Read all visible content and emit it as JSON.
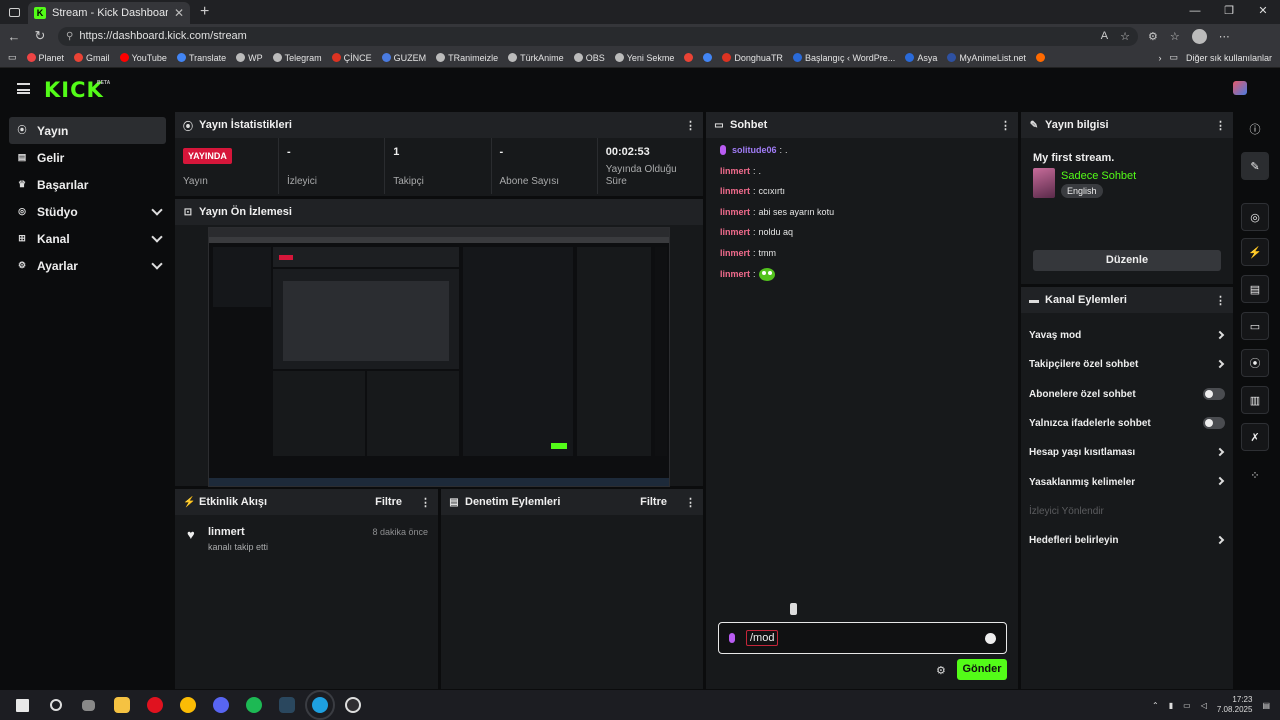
{
  "browser": {
    "tab_title": "Stream - Kick Dashboard",
    "tab_favicon": "K",
    "url": "https://dashboard.kick.com/stream",
    "bookmarks": [
      {
        "label": "Planet",
        "color": "#e44"
      },
      {
        "label": "Gmail",
        "color": "#ea4335"
      },
      {
        "label": "YouTube",
        "color": "#ff0000"
      },
      {
        "label": "Translate",
        "color": "#4285f4"
      },
      {
        "label": "WP",
        "color": "#bbb"
      },
      {
        "label": "Telegram",
        "color": "#bbb"
      },
      {
        "label": "ÇİNCE",
        "color": "#d32"
      },
      {
        "label": "GUZEM",
        "color": "#4a7be0"
      },
      {
        "label": "TRanimeizle",
        "color": "#bbb"
      },
      {
        "label": "TürkAnime",
        "color": "#bbb"
      },
      {
        "label": "OBS",
        "color": "#bbb"
      },
      {
        "label": "Yeni Sekme",
        "color": "#bbb"
      },
      {
        "label": "",
        "color": "#ea4335"
      },
      {
        "label": "",
        "color": "#4285f4"
      },
      {
        "label": "DonghuaTR",
        "color": "#d32"
      },
      {
        "label": "Başlangıç ‹ WordPre...",
        "color": "#2a6ad8"
      },
      {
        "label": "Asya",
        "color": "#2a6ad8"
      },
      {
        "label": "MyAnimeList.net",
        "color": "#2e51a2"
      },
      {
        "label": "",
        "color": "#ff6a00"
      }
    ],
    "other_bookmarks": "Diğer sık kullanılanlar"
  },
  "sidebar": {
    "items": [
      {
        "label": "Yayın",
        "icon": "broadcast-icon",
        "glyph": "((·))"
      },
      {
        "label": "Gelir",
        "icon": "revenue-icon",
        "glyph": "▤"
      },
      {
        "label": "Başarılar",
        "icon": "trophy-icon",
        "glyph": "♛"
      },
      {
        "label": "Stüdyo",
        "icon": "studio-icon",
        "glyph": "◎"
      },
      {
        "label": "Kanal",
        "icon": "channel-icon",
        "glyph": "⊞"
      },
      {
        "label": "Ayarlar",
        "icon": "settings-icon",
        "glyph": "⚙"
      }
    ]
  },
  "stats_panel": {
    "title": "Yayın İstatistikleri",
    "live_badge": "YAYINDA",
    "cells": [
      {
        "value": "",
        "label": "Yayın"
      },
      {
        "value": "-",
        "label": "İzleyici"
      },
      {
        "value": "1",
        "label": "Takipçi"
      },
      {
        "value": "-",
        "label": "Abone Sayısı"
      },
      {
        "value": "00:02:53",
        "label": "Yayında Olduğu Süre"
      }
    ]
  },
  "preview_panel": {
    "title": "Yayın Ön İzlemesi"
  },
  "events_panel": {
    "title": "Etkinlik Akışı",
    "filter": "Filtre",
    "events": [
      {
        "user": "linmert",
        "text": "kanalı takip etti",
        "time": "8 dakika önce"
      }
    ]
  },
  "mod_panel": {
    "title": "Denetim Eylemleri",
    "filter": "Filtre"
  },
  "chat_panel": {
    "title": "Sohbet",
    "messages": [
      {
        "user": "solitude06",
        "text": ".",
        "style": "purple"
      },
      {
        "user": "linmert",
        "text": ".",
        "style": "pink"
      },
      {
        "user": "linmert",
        "text": "ccıxırtı",
        "style": "pink"
      },
      {
        "user": "linmert",
        "text": "abi ses ayarın kotu",
        "style": "pink"
      },
      {
        "user": "linmert",
        "text": "noldu aq",
        "style": "pink"
      },
      {
        "user": "linmert",
        "text": "tmm",
        "style": "pink"
      },
      {
        "user": "linmert",
        "text": "",
        "style": "pink",
        "emote": true
      }
    ],
    "input_value": "/mod",
    "send_label": "Gönder"
  },
  "stream_info": {
    "title": "Yayın bilgisi",
    "stream_title": "My first stream.",
    "category": "Sadece Sohbet",
    "language": "English",
    "edit_label": "Düzenle"
  },
  "channel_actions": {
    "title": "Kanal Eylemleri",
    "items": [
      {
        "label": "Yavaş mod",
        "control": "chevron"
      },
      {
        "label": "Takipçilere özel sohbet",
        "control": "chevron"
      },
      {
        "label": "Abonelere özel sohbet",
        "control": "toggle"
      },
      {
        "label": "Yalnızca ifadelerle sohbet",
        "control": "toggle"
      },
      {
        "label": "Hesap yaşı kısıtlaması",
        "control": "chevron"
      },
      {
        "label": "Yasaklanmış kelimeler",
        "control": "chevron"
      },
      {
        "label": "İzleyici Yönlendir",
        "control": "none",
        "disabled": true
      },
      {
        "label": "Hedefleri belirleyin",
        "control": "chevron"
      }
    ]
  },
  "taskbar": {
    "time": "17:23",
    "date": "7.08.2025"
  }
}
